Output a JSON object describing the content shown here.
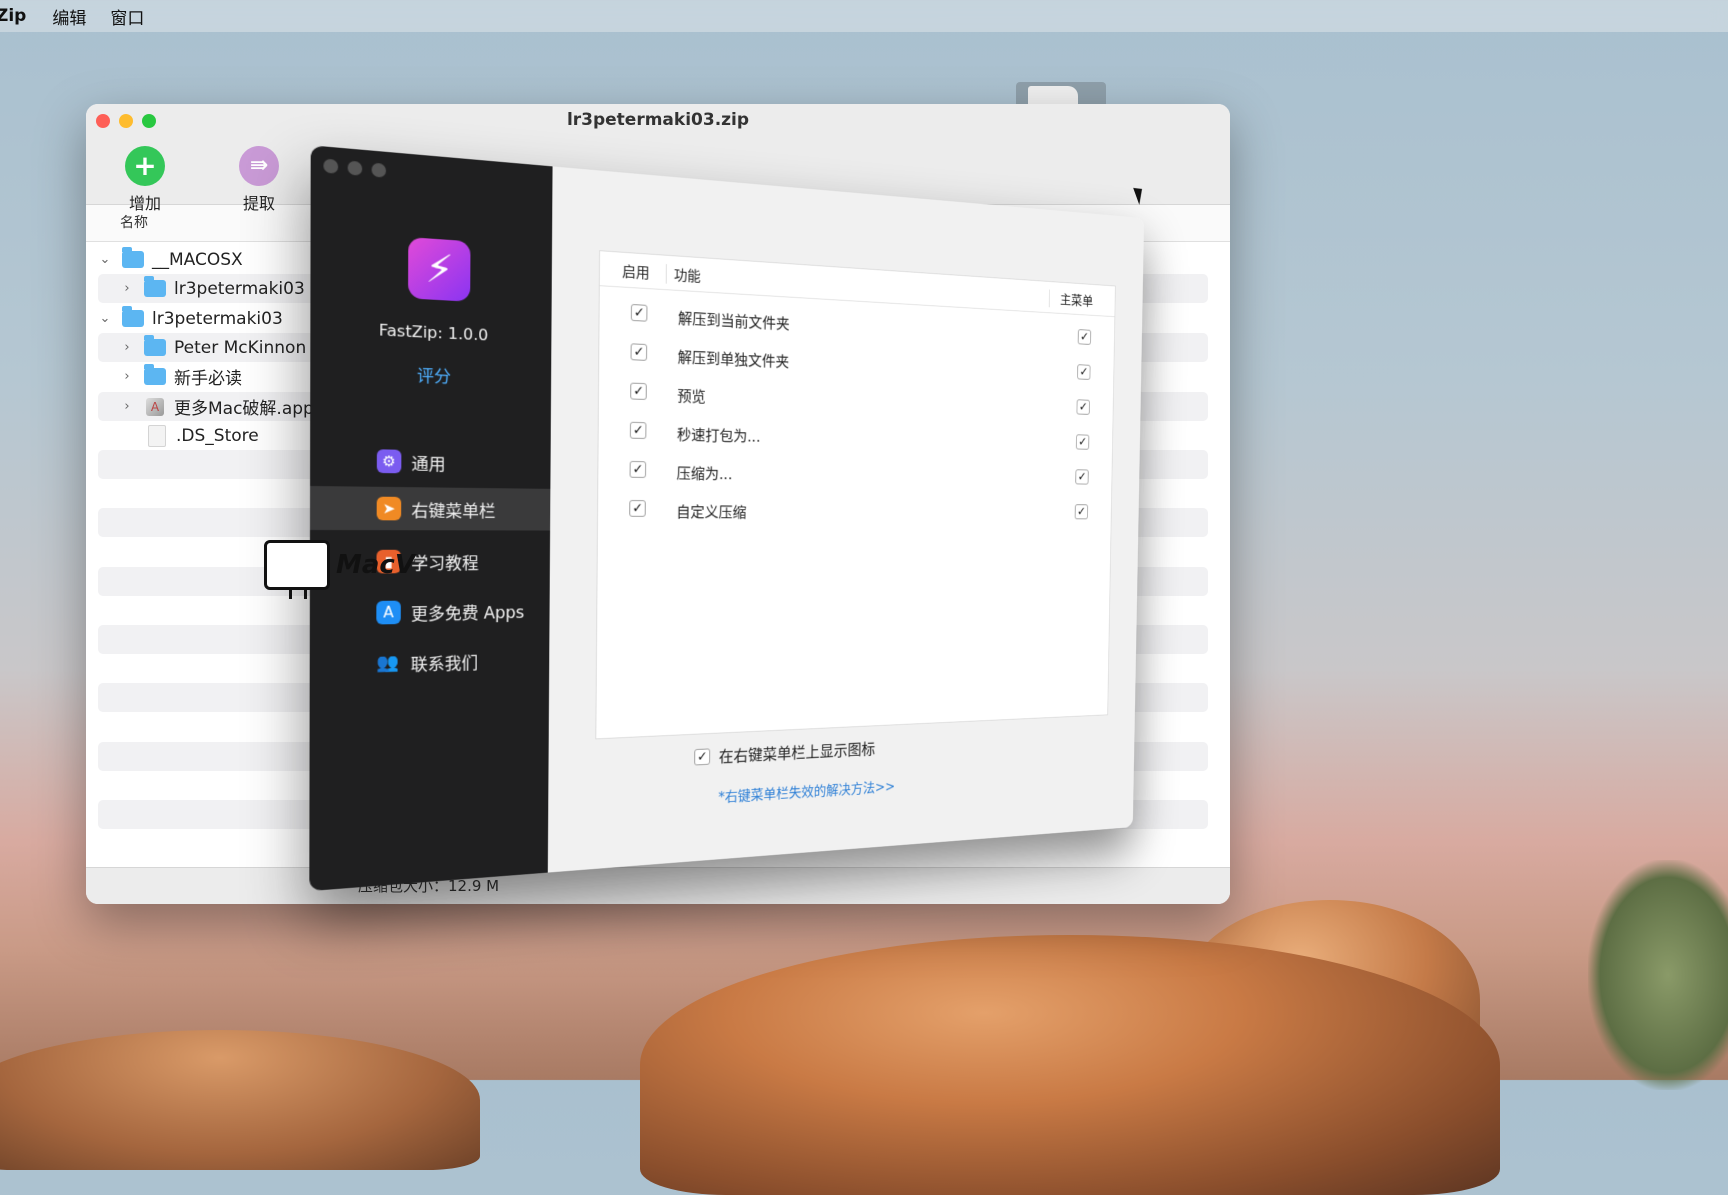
{
  "menubar": {
    "app": "Zip",
    "items": [
      "编辑",
      "窗口"
    ]
  },
  "archive_window": {
    "title": "lr3petermaki03.zip",
    "toolbar": [
      {
        "label": "增加",
        "icon": "plus-icon",
        "color": "#34c759"
      },
      {
        "label": "提取",
        "icon": "extract-arrow-icon",
        "color": "#c99ad6"
      }
    ],
    "column_header": "名称",
    "rows": [
      {
        "name": "__MACOSX",
        "type": "folder",
        "expanded": true,
        "level": 0
      },
      {
        "name": "lr3petermaki03",
        "type": "folder",
        "expanded": false,
        "level": 1
      },
      {
        "name": "lr3petermaki03",
        "type": "folder",
        "expanded": true,
        "level": 0
      },
      {
        "name": "Peter McKinnon v3",
        "type": "folder",
        "expanded": false,
        "level": 1
      },
      {
        "name": "新手必读",
        "type": "folder",
        "expanded": false,
        "level": 1
      },
      {
        "name": "更多Mac破解.app",
        "type": "app",
        "expanded": false,
        "level": 1
      },
      {
        "name": ".DS_Store",
        "type": "file",
        "level": 1
      }
    ],
    "status": "压缩包大小：12.9 M"
  },
  "watermark": {
    "text": "MacV"
  },
  "prefs_window": {
    "app_version": "FastZip: 1.0.0",
    "rate_label": "评分",
    "nav": [
      {
        "label": "通用",
        "icon": "gear-icon",
        "color": "#7b5cf0",
        "selected": false
      },
      {
        "label": "右键菜单栏",
        "icon": "cursor-icon",
        "color": "#f08a24",
        "selected": true
      },
      {
        "label": "学习教程",
        "icon": "book-icon",
        "color": "#e8602c",
        "selected": false
      },
      {
        "label": "更多免费 Apps",
        "icon": "app-store-icon",
        "color": "#1e8ef5",
        "selected": false
      },
      {
        "label": "联系我们",
        "icon": "contacts-icon",
        "color": "#1f1f20",
        "selected": false
      }
    ],
    "table": {
      "headers": {
        "enable": "启用",
        "function": "功能",
        "main_menu": "主菜单"
      },
      "rows": [
        {
          "label": "解压到当前文件夹",
          "enabled": true,
          "main_menu": true
        },
        {
          "label": "解压到单独文件夹",
          "enabled": true,
          "main_menu": true
        },
        {
          "label": "预览",
          "enabled": true,
          "main_menu": true
        },
        {
          "label": "秒速打包为...",
          "enabled": true,
          "main_menu": true
        },
        {
          "label": "压缩为...",
          "enabled": true,
          "main_menu": true
        },
        {
          "label": "自定义压缩",
          "enabled": true,
          "main_menu": true
        }
      ]
    },
    "show_icon_option": {
      "label": "在右键菜单栏上显示图标",
      "checked": true
    },
    "help_link": "*右键菜单栏失效的解决方法>>"
  }
}
